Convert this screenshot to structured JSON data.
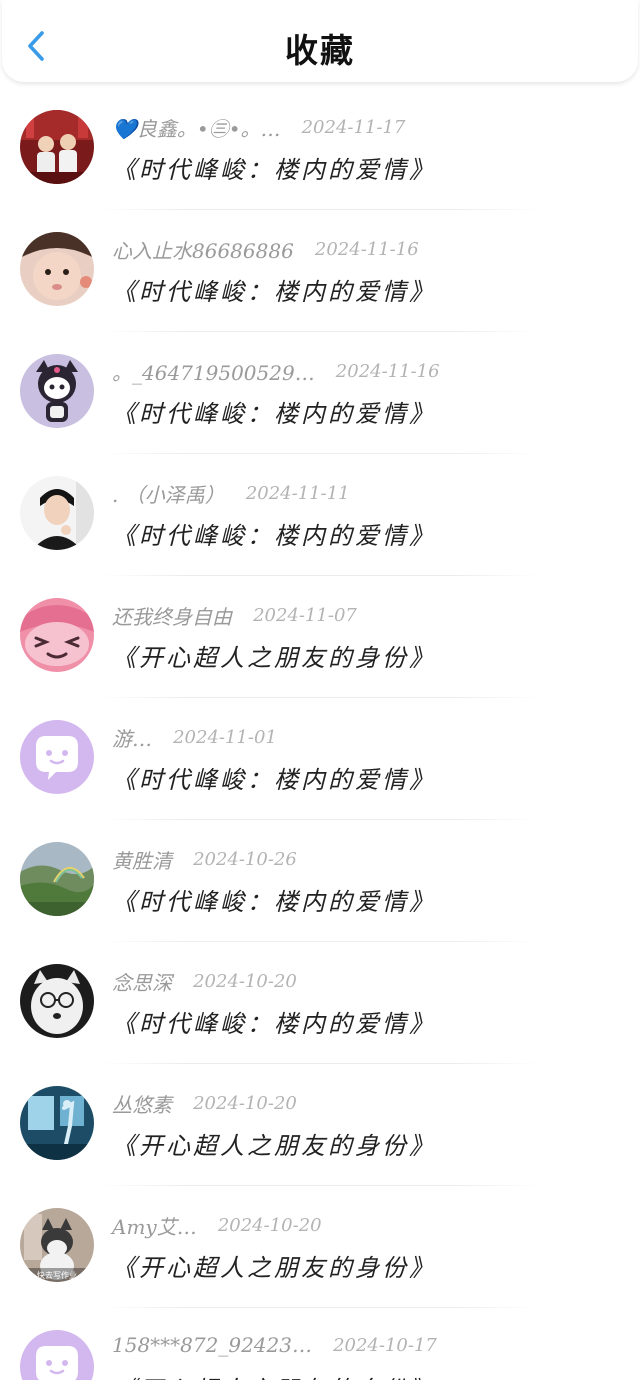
{
  "header": {
    "title": "收藏",
    "back_icon": "chevron-left-icon",
    "accent_color": "#3a9be8"
  },
  "favorites": [
    {
      "username": "💙良鑫。•㊂•。…",
      "date": "2024-11-17",
      "title": "《时代峰峻：楼内的爱情》",
      "avatar": "photo-two-kids-red-stage"
    },
    {
      "username": "心入止水86686886",
      "date": "2024-11-16",
      "title": "《时代峰峻：楼内的爱情》",
      "avatar": "photo-baby-face"
    },
    {
      "username": "。_464719500529…",
      "date": "2024-11-16",
      "title": "《时代峰峻：楼内的爱情》",
      "avatar": "kuromi-doll"
    },
    {
      "username": ". （小泽禹）",
      "date": "2024-11-11",
      "title": "《时代峰峻：楼内的爱情》",
      "avatar": "photo-young-man"
    },
    {
      "username": "还我终身自由",
      "date": "2024-11-07",
      "title": "《开心超人之朋友的身份》",
      "avatar": "cartoon-pink-face"
    },
    {
      "username": "游…",
      "date": "2024-11-01",
      "title": "《时代峰峻：楼内的爱情》",
      "avatar": "default-purple-chat"
    },
    {
      "username": "黄胜清",
      "date": "2024-10-26",
      "title": "《时代峰峻：楼内的爱情》",
      "avatar": "photo-green-landscape-rainbow"
    },
    {
      "username": "念思深",
      "date": "2024-10-20",
      "title": "《时代峰峻：楼内的爱情》",
      "avatar": "photo-white-dog-glasses"
    },
    {
      "username": "丛悠素",
      "date": "2024-10-20",
      "title": "《开心超人之朋友的身份》",
      "avatar": "photo-blue-room-figure"
    },
    {
      "username": "Amy艾…",
      "date": "2024-10-20",
      "title": "《开心超人之朋友的身份》",
      "avatar": "photo-cat-with-caption",
      "avatar_caption": "快去写作业"
    },
    {
      "username": "158***872_92423…",
      "date": "2024-10-17",
      "title": "《开心超人之朋友的身份》",
      "avatar": "default-purple-chat"
    }
  ]
}
